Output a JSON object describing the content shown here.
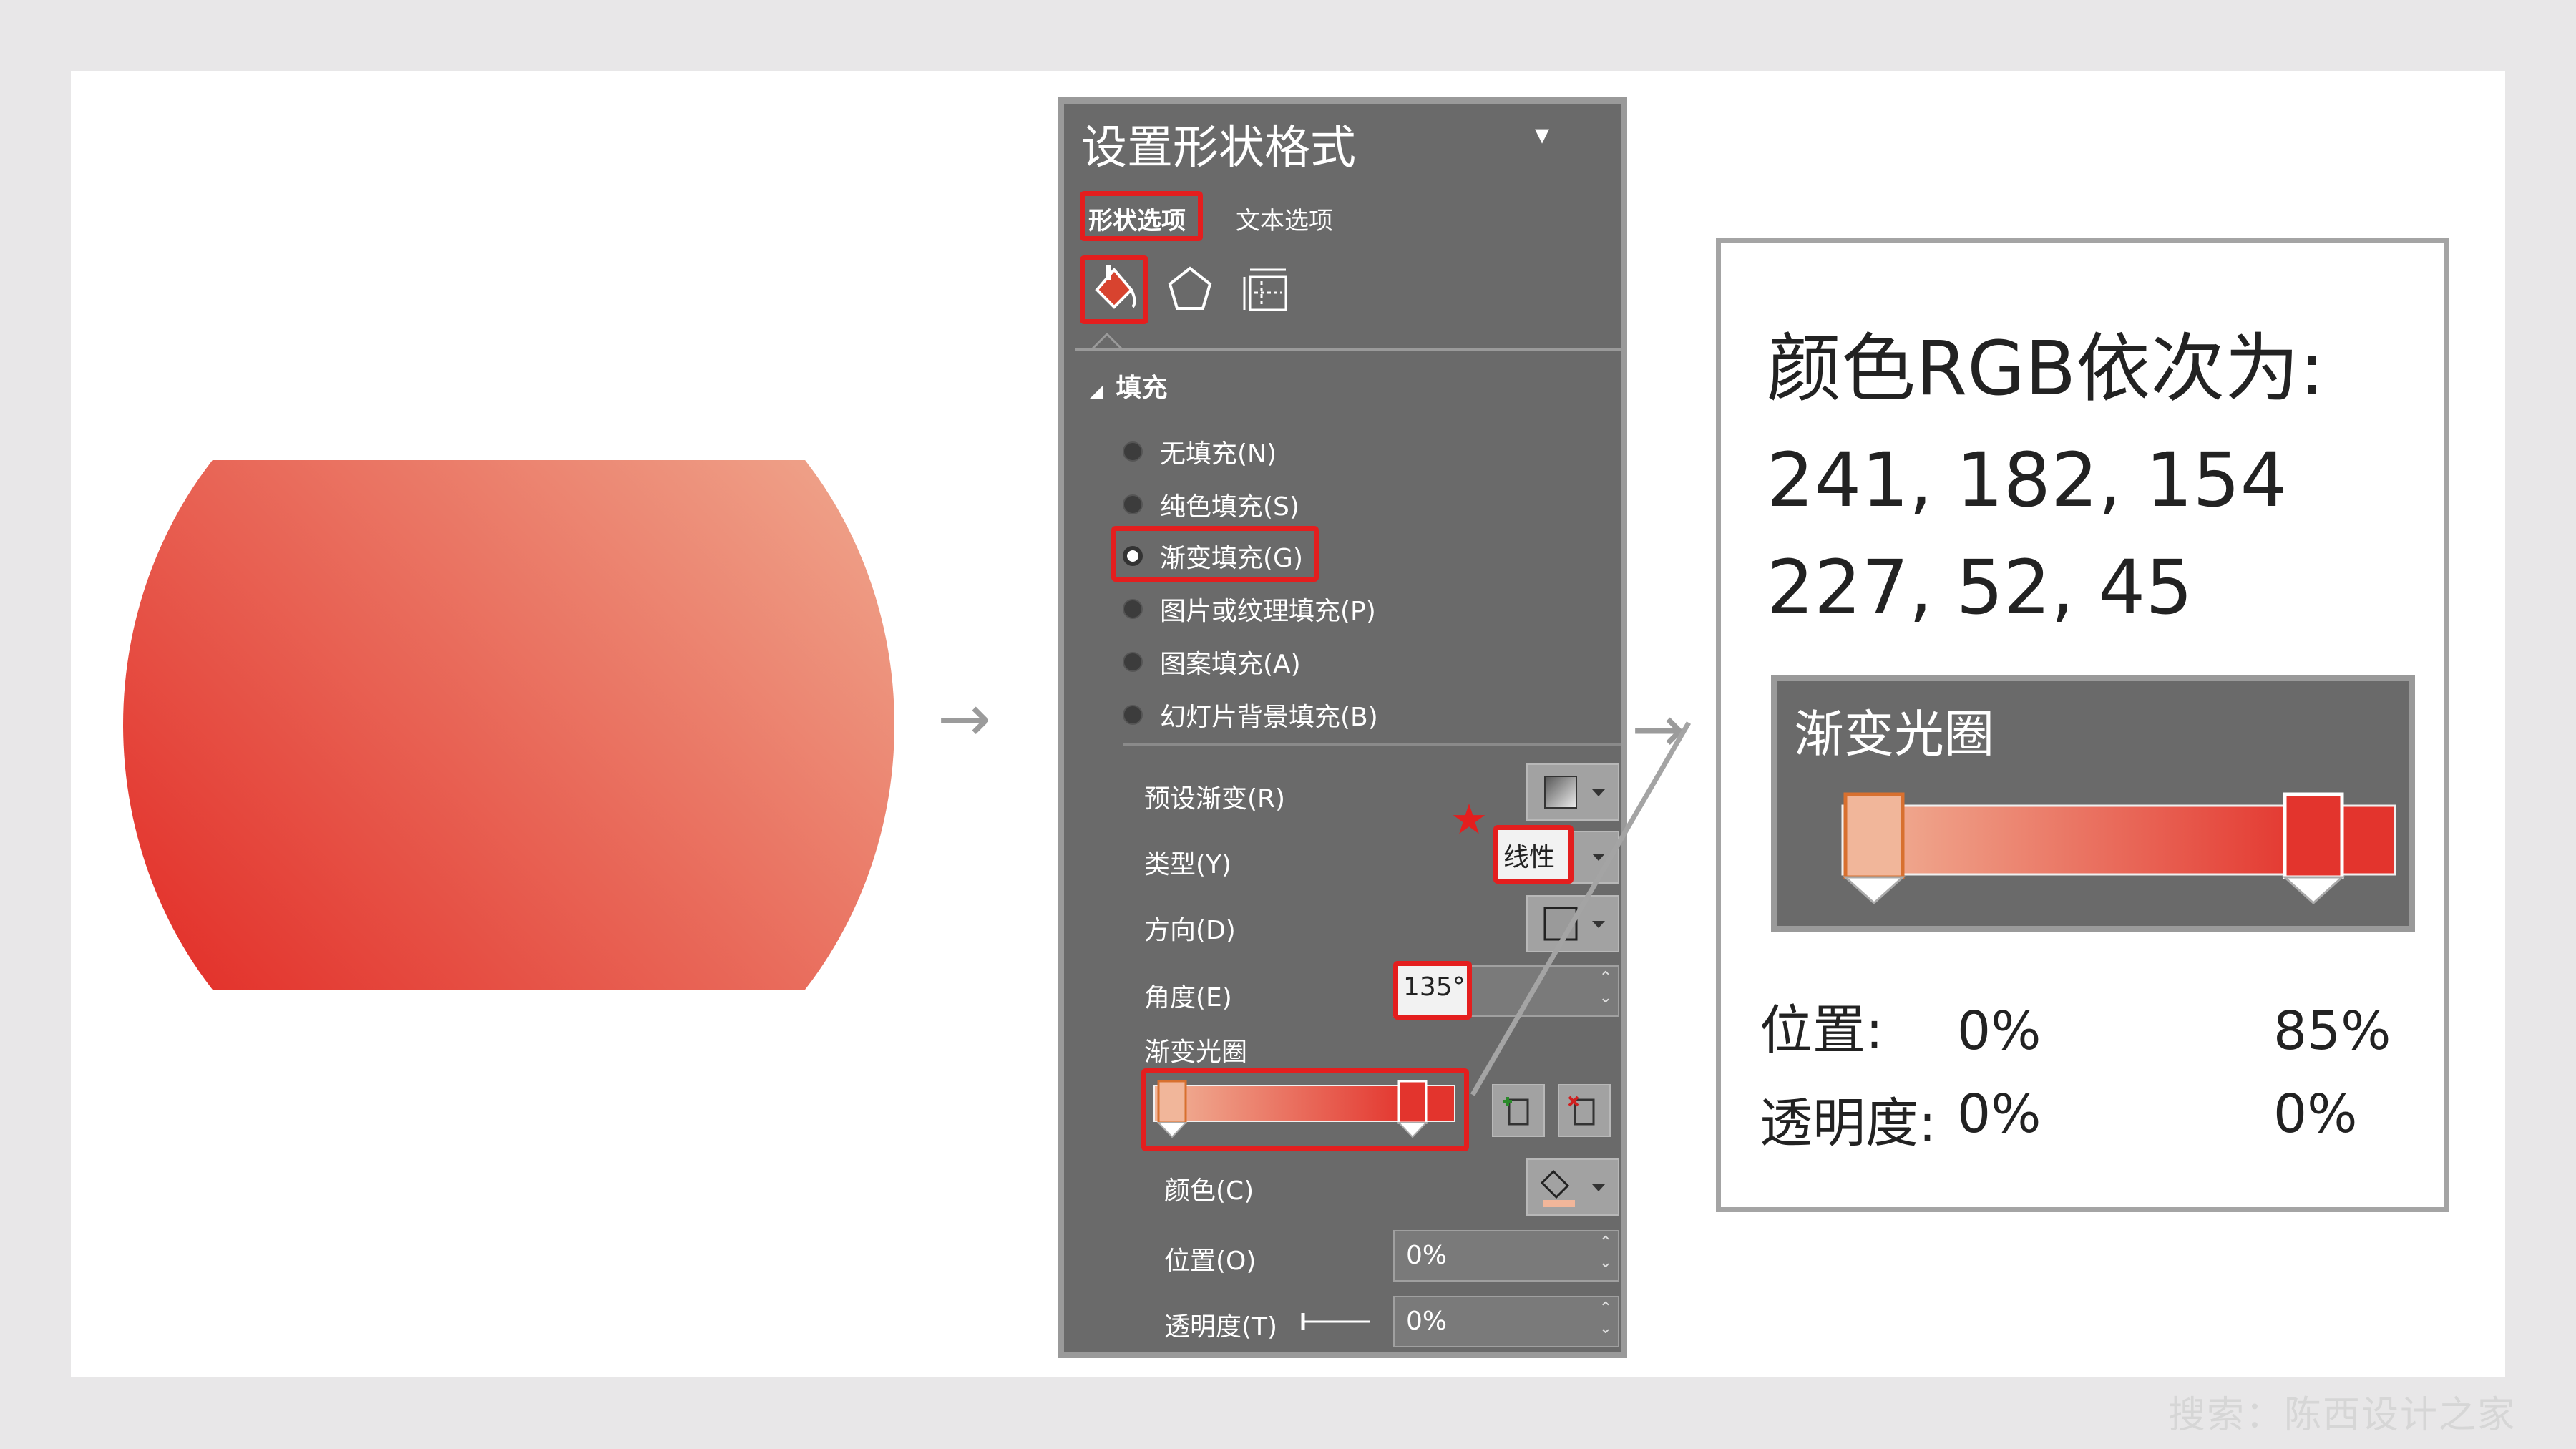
{
  "pane": {
    "title": "设置形状格式",
    "tabs": {
      "shape_options": "形状选项",
      "text_options": "文本选项"
    },
    "section_fill": "填充",
    "fill_options": [
      "无填充(N)",
      "纯色填充(S)",
      "渐变填充(G)",
      "图片或纹理填充(P)",
      "图案填充(A)",
      "幻灯片背景填充(B)"
    ],
    "selected_fill_index": 2,
    "preset_gradient_label": "预设渐变(R)",
    "type_label": "类型(Y)",
    "type_value": "线性",
    "direction_label": "方向(D)",
    "angle_label": "角度(E)",
    "angle_value": "135°",
    "gradient_stops_label": "渐变光圈",
    "color_label": "颜色(C)",
    "position_label": "位置(O)",
    "position_value": "0%",
    "transparency_label": "透明度(T)",
    "transparency_value": "0%"
  },
  "info": {
    "title": "颜色RGB依次为:",
    "rgb1": "241, 182, 154",
    "rgb2": "227, 52, 45",
    "stops_title": "渐变光圈",
    "position_label": "位置:",
    "transparency_label": "透明度:",
    "stop1_position": "0%",
    "stop2_position": "85%",
    "stop1_transparency": "0%",
    "stop2_transparency": "0%"
  },
  "colors": {
    "stop1": "#f1b69a",
    "stop2": "#e3342d",
    "highlight": "#e41e1e",
    "pane_bg": "#6a6a6a"
  },
  "watermark": "搜索：陈西设计之家"
}
